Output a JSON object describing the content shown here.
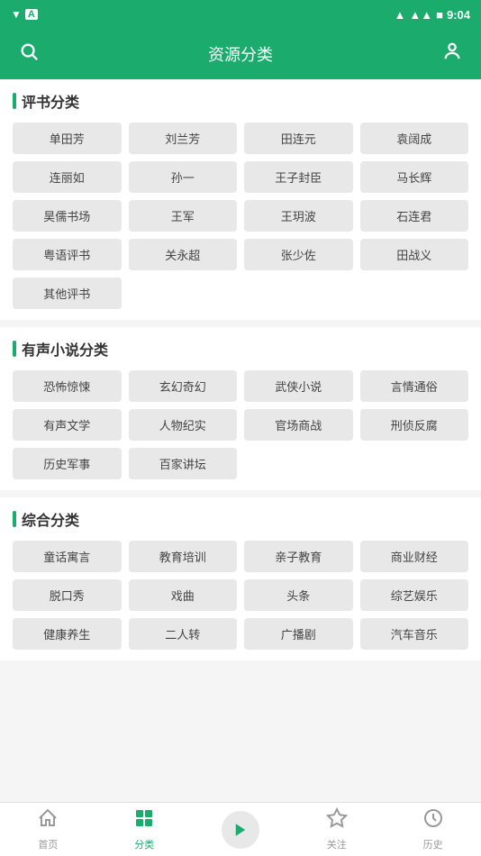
{
  "statusBar": {
    "leftIcons": "A",
    "time": "9:04",
    "signal": "▲",
    "battery": "🔋"
  },
  "header": {
    "title": "资源分类",
    "searchIcon": "🔍",
    "userIcon": "👤"
  },
  "sections": [
    {
      "id": "pingshufenlei",
      "title": "评书分类",
      "tags": [
        "单田芳",
        "刘兰芳",
        "田连元",
        "袁阔成",
        "连丽如",
        "孙一",
        "王子封臣",
        "马长辉",
        "昊儒书场",
        "王军",
        "王玥波",
        "石连君",
        "粤语评书",
        "关永超",
        "张少佐",
        "田战义",
        "其他评书"
      ]
    },
    {
      "id": "youshengxiaoshuo",
      "title": "有声小说分类",
      "tags": [
        "恐怖惊悚",
        "玄幻奇幻",
        "武侠小说",
        "言情通俗",
        "有声文学",
        "人物纪实",
        "官场商战",
        "刑侦反腐",
        "历史军事",
        "百家讲坛"
      ]
    },
    {
      "id": "zonghe",
      "title": "综合分类",
      "tags": [
        "童话寓言",
        "教育培训",
        "亲子教育",
        "商业财经",
        "脱口秀",
        "戏曲",
        "头条",
        "综艺娱乐",
        "健康养生",
        "二人转",
        "广播剧",
        "汽车音乐"
      ]
    }
  ],
  "bottomNav": [
    {
      "id": "home",
      "label": "首页",
      "icon": "⌂",
      "active": false
    },
    {
      "id": "category",
      "label": "分类",
      "icon": "grid",
      "active": true
    },
    {
      "id": "play",
      "label": "",
      "icon": "▶",
      "active": false
    },
    {
      "id": "follow",
      "label": "关注",
      "icon": "☆",
      "active": false
    },
    {
      "id": "history",
      "label": "历史",
      "icon": "🕐",
      "active": false
    }
  ]
}
